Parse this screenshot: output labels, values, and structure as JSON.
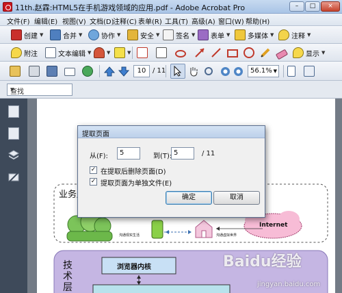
{
  "window": {
    "title": "11th.赵霖:HTML5在手机游戏领域的应用.pdf - Adobe Acrobat Pro",
    "min": "–",
    "max": "□",
    "close": "×"
  },
  "menu": [
    "文件(F)",
    "编辑(E)",
    "视图(V)",
    "文档(D)",
    "注释(C)",
    "表单(R)",
    "工具(T)",
    "高级(A)",
    "窗口(W)",
    "帮助(H)"
  ],
  "toolbar1": {
    "create": "创建",
    "combine": "合并",
    "collaborate": "协作",
    "secure": "安全",
    "sign": "签名",
    "forms": "表单",
    "multimedia": "多媒体",
    "comment": "注释"
  },
  "toolbar2": {
    "note": "附注",
    "text_edit": "文本编辑",
    "show": "显示"
  },
  "toolbar3": {
    "page_current": "10",
    "page_total": "/ 11",
    "zoom": "56.1%"
  },
  "find": {
    "placeholder": "查找"
  },
  "dialog": {
    "title": "提取页面",
    "from_label": "从(F):",
    "from_value": "5",
    "to_label": "到(T):",
    "to_value": "5",
    "of_total": "/ 11",
    "delete_after": "在提取后删除页面(D)",
    "separate_files": "提取页面为单独文件(E)",
    "ok": "确定",
    "cancel": "取消"
  },
  "page_content": {
    "business_layer": "业务层",
    "tech_layer": "技术层",
    "label_life": "沟通现实生活",
    "label_virtual": "沟通虚拟世界",
    "internet": "Internet",
    "browser_kernel": "浏览器内核"
  },
  "watermark": {
    "brand": "Baidu经验",
    "url": "jingyan.baidu.com"
  }
}
